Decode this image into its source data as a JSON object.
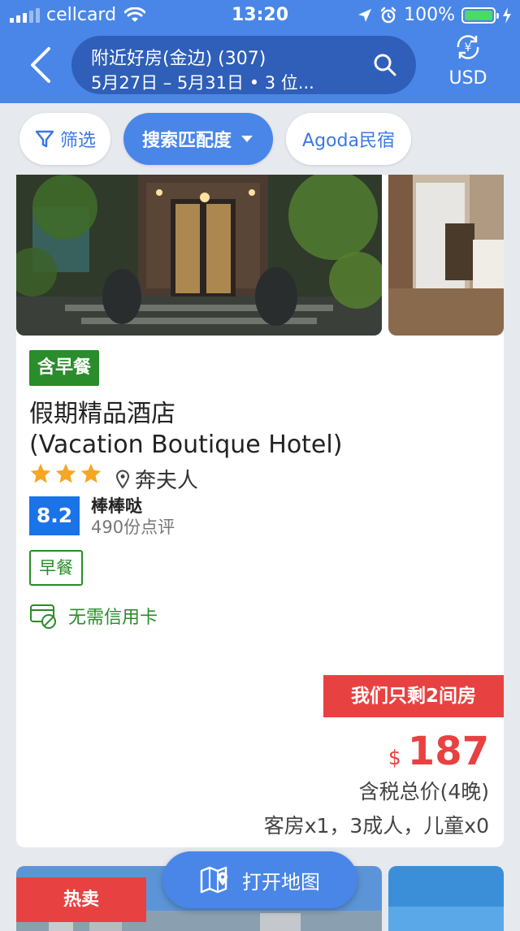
{
  "status_bar": {
    "carrier": "cellcard",
    "time": "13:20",
    "battery": "100%"
  },
  "header": {
    "search_title": "附近好房(金边) (307)",
    "search_subtitle": "5月27日 – 5月31日 • 3 位...",
    "currency": "USD"
  },
  "filters": {
    "filter_label": "筛选",
    "sort_label": "搜索匹配度",
    "homes_label": "Agoda民宿"
  },
  "hotel": {
    "badge": "含早餐",
    "name_cn": "假期精品酒店",
    "name_en": "(Vacation Boutique Hotel)",
    "stars": 3,
    "location": "奔夫人",
    "score": "8.2",
    "score_label": "棒棒哒",
    "review_count": "490份点评",
    "tag": "早餐",
    "no_credit_card": "无需信用卡",
    "rooms_left": "我们只剩2间房",
    "price_currency": "$",
    "price": "187",
    "price_note": "含税总价(4晚)",
    "room_info": "客房x1，3成人，儿童x0"
  },
  "next_card": {
    "badge": "热卖"
  },
  "map_button": {
    "label": "打开地图"
  },
  "colors": {
    "primary": "#4a86e8",
    "dark_pill": "#2f5fb8",
    "green": "#2a8c2a",
    "red": "#e84141",
    "score_blue": "#1a73e8",
    "star": "#f5a623"
  }
}
